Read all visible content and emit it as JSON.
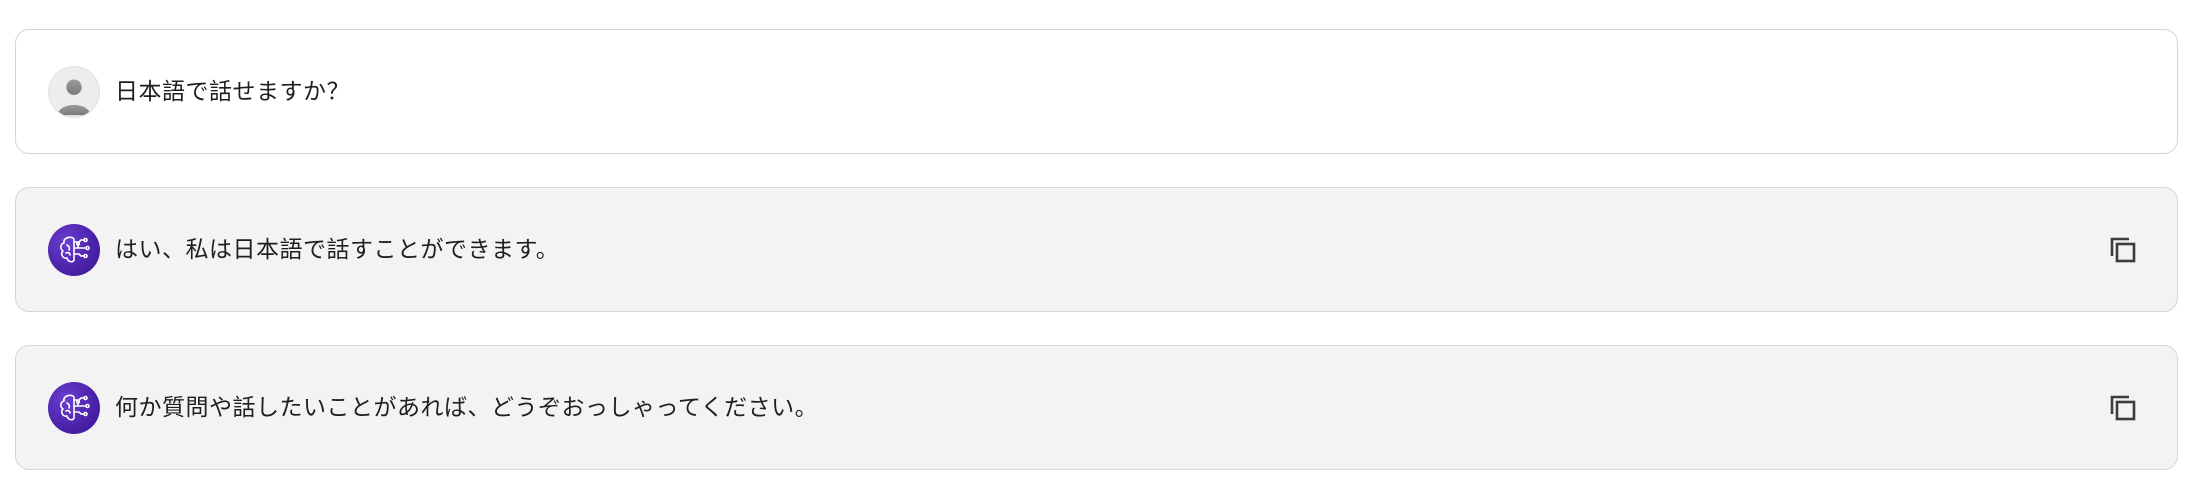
{
  "conversation": {
    "messages": [
      {
        "role": "user",
        "avatar_icon": "user-silhouette-icon",
        "text": "日本語で話せますか？"
      },
      {
        "role": "assistant",
        "avatar_icon": "ai-brain-circuit-icon",
        "text": "はい、私は日本語で話すことができます。",
        "action_icon": "copy-icon"
      },
      {
        "role": "assistant",
        "avatar_icon": "ai-brain-circuit-icon",
        "text": "何か質問や話したいことがあれば、どうぞおっしゃってください。",
        "action_icon": "copy-icon"
      }
    ]
  },
  "colors": {
    "user_bubble_bg": "#ffffff",
    "assistant_bubble_bg": "#f3f3f3",
    "border": "#d5d5d5",
    "bot_avatar": "#4a21a8",
    "icon": "#3c3c3c"
  }
}
